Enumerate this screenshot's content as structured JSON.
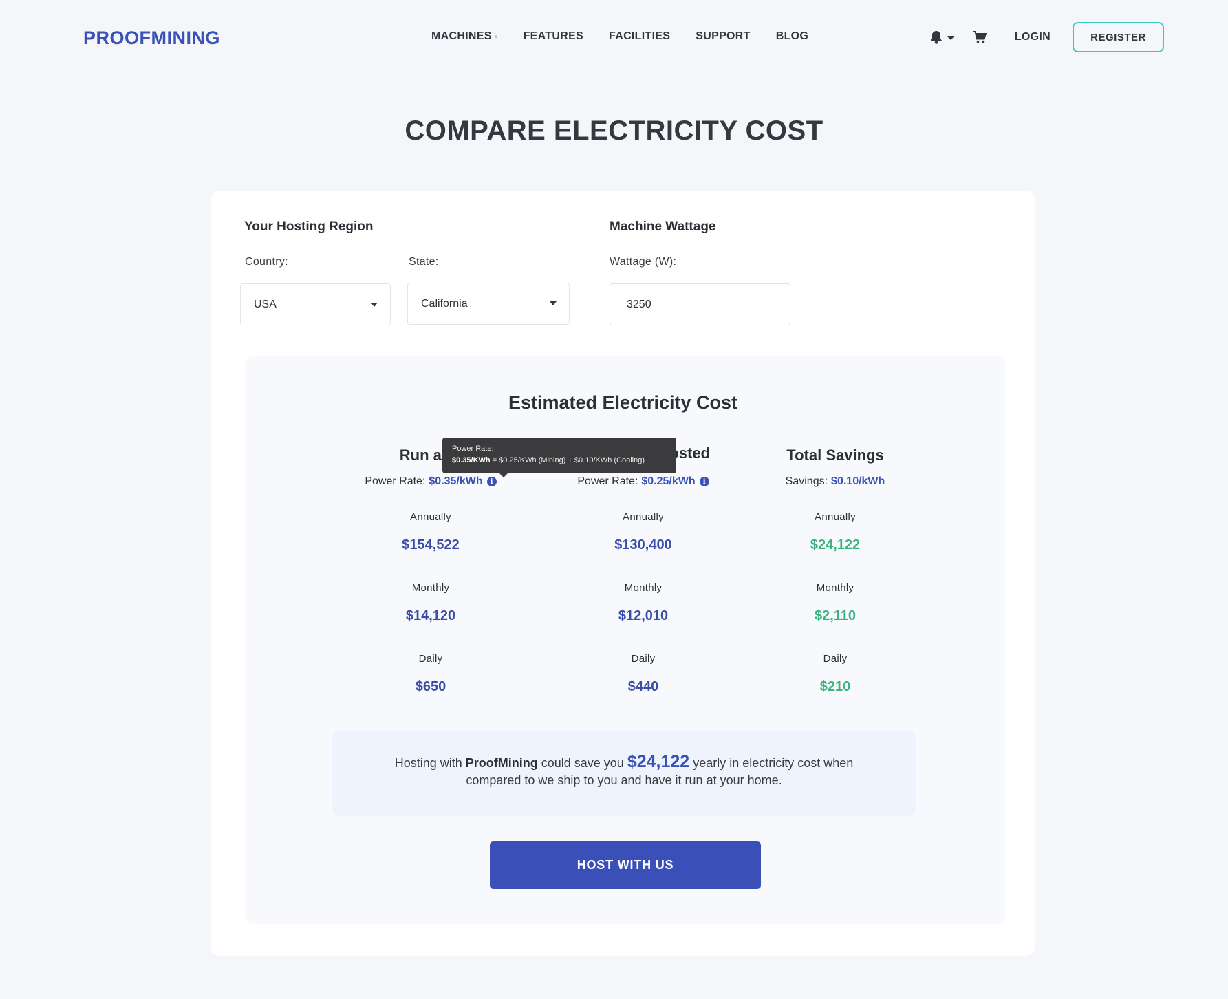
{
  "brand": {
    "logo_part1": "PROOF",
    "logo_part2": "MINING"
  },
  "nav": {
    "items": [
      {
        "label": "MACHINES"
      },
      {
        "label": "FEATURES"
      },
      {
        "label": "FACILITIES"
      },
      {
        "label": "SUPPORT"
      },
      {
        "label": "BLOG"
      }
    ],
    "login": "LOGIN",
    "register": "REGISTER"
  },
  "page": {
    "title": "COMPARE ELECTRICITY COST"
  },
  "region": {
    "heading": "Your Hosting Region",
    "country_label": "Country:",
    "country_value": "USA",
    "state_label": "State:",
    "state_value": "California"
  },
  "wattage": {
    "heading": "Machine Wattage",
    "label": "Wattage (W):",
    "value": "3250"
  },
  "estimate": {
    "title": "Estimated Electricity Cost",
    "columns": [
      {
        "heading": "Run at H",
        "rate_label": "Power Rate:",
        "rate_value": "$0.35/kWh",
        "annually_label": "Annually",
        "annually": "$154,522",
        "monthly_label": "Monthly",
        "monthly": "$14,120",
        "daily_label": "Daily",
        "daily": "$650"
      },
      {
        "heading": "osted",
        "rate_label": "Power Rate:",
        "rate_value": "$0.25/kWh",
        "annually_label": "Annually",
        "annually": "$130,400",
        "monthly_label": "Monthly",
        "monthly": "$12,010",
        "daily_label": "Daily",
        "daily": "$440"
      },
      {
        "heading": "Total Savings",
        "rate_label": "Savings:",
        "rate_value": "$0.10/kWh",
        "annually_label": "Annually",
        "annually": "$24,122",
        "monthly_label": "Monthly",
        "monthly": "$2,110",
        "daily_label": "Daily",
        "daily": "$210"
      }
    ],
    "tooltip": {
      "title": "Power Rate:",
      "bold": "$0.35/KWh",
      "rest": " = $0.25/KWh (Mining) + $0.10/KWh (Cooling)"
    }
  },
  "savings_msg": {
    "pre": "Hosting with ",
    "brand": "ProofMining",
    "mid": " could save you ",
    "amount": "$24,122",
    "post": " yearly in electricity cost when",
    "line2": "compared to we ship to you and have it run at your home."
  },
  "cta": {
    "label": "HOST WITH US"
  },
  "colors": {
    "brand_blue": "#3a52b8",
    "savings_green": "#3ab37f",
    "register_border": "#3cc8c2"
  }
}
